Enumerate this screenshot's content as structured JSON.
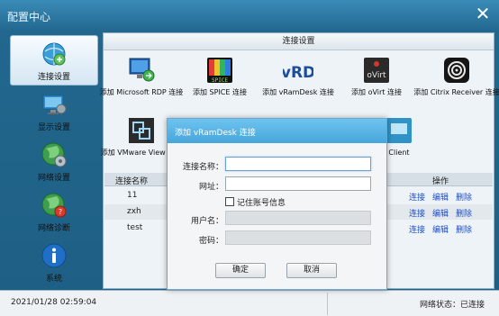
{
  "app": {
    "title": "配置中心",
    "close_glyph": "✕"
  },
  "sidebar": {
    "items": [
      {
        "label": "连接设置",
        "icon": "globe-connection-icon",
        "active": true
      },
      {
        "label": "显示设置",
        "icon": "monitor-settings-icon",
        "active": false
      },
      {
        "label": "网络设置",
        "icon": "network-globe-icon",
        "active": false
      },
      {
        "label": "网络诊断",
        "icon": "network-diagnosis-icon",
        "active": false
      },
      {
        "label": "系统",
        "icon": "info-icon",
        "active": false
      }
    ]
  },
  "content": {
    "section_title": "连接设置",
    "tiles": [
      {
        "label": "添加 Microsoft RDP 连接",
        "icon": "rdp-icon"
      },
      {
        "label": "添加 SPICE 连接",
        "icon": "spice-icon"
      },
      {
        "label": "添加 vRamDesk 连接",
        "icon": "vrd-icon",
        "icon_text": "vRD"
      },
      {
        "label": "添加 oVirt 连接",
        "icon": "ovirt-icon",
        "icon_text": "oVirt"
      },
      {
        "label": "添加 Citrix Receiver 连接",
        "icon": "citrix-icon"
      },
      {
        "label": "添加 VMware View 连接",
        "icon": "vmware-icon"
      },
      {
        "label": "Client",
        "icon": "client-icon"
      }
    ],
    "table": {
      "col_name": "连接名称",
      "col_ops": "操作",
      "op_labels": [
        "连接",
        "编辑",
        "删除"
      ],
      "rows": [
        {
          "name": "11"
        },
        {
          "name": "zxh"
        },
        {
          "name": "test"
        }
      ]
    }
  },
  "status": {
    "datetime": "2021/01/28 02:59:04",
    "network": "网络状态：已连接"
  },
  "dialog": {
    "title": "添加 vRamDesk 连接",
    "name_label": "连接名称：",
    "name_value": "",
    "address_label": "网址：",
    "address_value": "",
    "remember_label": "记住账号信息",
    "remember_checked": false,
    "user_label": "用户名：",
    "password_label": "密码：",
    "ok_label": "确定",
    "cancel_label": "取消"
  },
  "colors": {
    "title_bar": "#2a79a7",
    "dialog_header": "#5ab4e4",
    "link": "#1c4fd1"
  }
}
